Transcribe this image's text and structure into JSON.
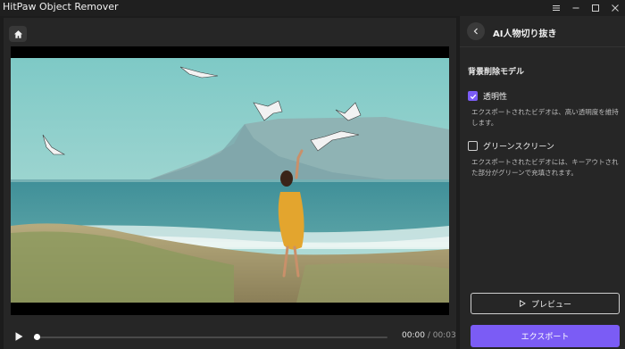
{
  "app": {
    "title": "HitPaw Object Remover"
  },
  "player": {
    "current_time": "00:00",
    "separator": "/",
    "total_time": "00:03",
    "progress": 0.01
  },
  "panel": {
    "title": "AI人物切り抜き",
    "section_title": "背景削除モデル",
    "options": [
      {
        "label": "透明性",
        "checked": true,
        "description": "エクスポートされたビデオは、高い透明度を維持します。"
      },
      {
        "label": "グリーンスクリーン",
        "checked": false,
        "description": "エクスポートされたビデオには、キーアウトされた部分がグリーンで充填されます。"
      }
    ],
    "preview_label": "プレビュー",
    "export_label": "エクスポート"
  },
  "colors": {
    "accent": "#7b5cf5",
    "background": "#1c1c1c",
    "panel": "#262626"
  },
  "icons": [
    "home-icon",
    "menu-icon",
    "minimize-icon",
    "maximize-icon",
    "close-icon",
    "back-chevron-icon",
    "play-icon",
    "checkmark-icon"
  ]
}
